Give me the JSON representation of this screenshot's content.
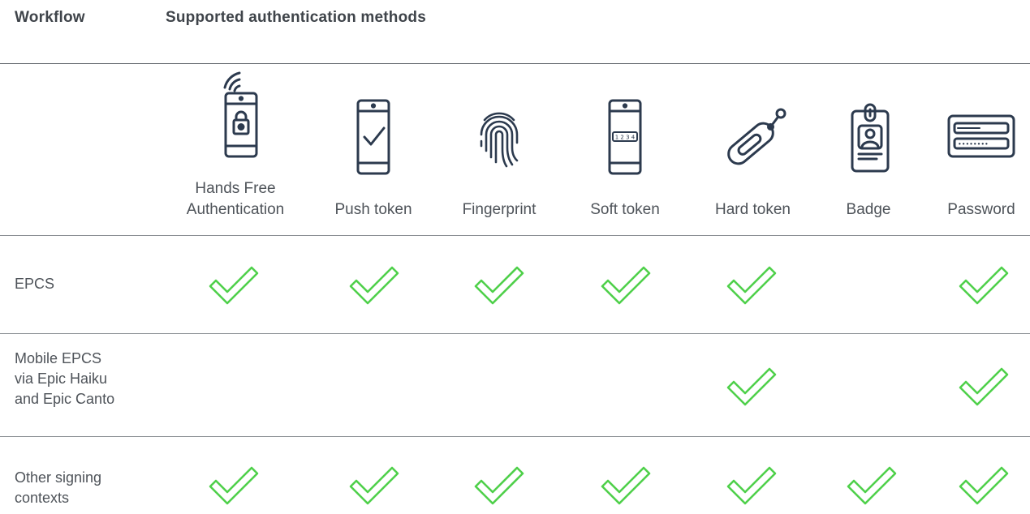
{
  "header": {
    "workflow": "Workflow",
    "methods": "Supported authentication methods"
  },
  "methods": [
    {
      "id": "hands-free",
      "label_line1": "Hands Free",
      "label_line2": "Authentication",
      "icon": "phone-wireless-lock-icon"
    },
    {
      "id": "push-token",
      "label_line1": "Push token",
      "icon": "phone-checkmark-icon"
    },
    {
      "id": "fingerprint",
      "label_line1": "Fingerprint",
      "icon": "fingerprint-icon"
    },
    {
      "id": "soft-token",
      "label_line1": "Soft token",
      "icon": "phone-code-icon"
    },
    {
      "id": "hard-token",
      "label_line1": "Hard token",
      "icon": "usb-token-icon"
    },
    {
      "id": "badge",
      "label_line1": "Badge",
      "icon": "id-badge-icon"
    },
    {
      "id": "password",
      "label_line1": "Password",
      "icon": "password-form-icon"
    }
  ],
  "soft_token_code": "1 2 3 4",
  "password_dots": "••••••••",
  "rows": [
    {
      "label_lines": [
        "EPCS"
      ],
      "support": [
        true,
        true,
        true,
        true,
        true,
        false,
        true
      ]
    },
    {
      "label_lines": [
        "Mobile EPCS",
        "via Epic Haiku",
        "and Epic Canto"
      ],
      "support": [
        false,
        false,
        false,
        false,
        true,
        false,
        true
      ]
    },
    {
      "label_lines": [
        "Other signing",
        "contexts"
      ],
      "support": [
        true,
        true,
        true,
        true,
        true,
        true,
        true
      ]
    }
  ],
  "colors": {
    "check": "#4fd04a",
    "icon_stroke": "#2c3a4e",
    "rule": "#5b6066",
    "text": "#4e5359"
  }
}
